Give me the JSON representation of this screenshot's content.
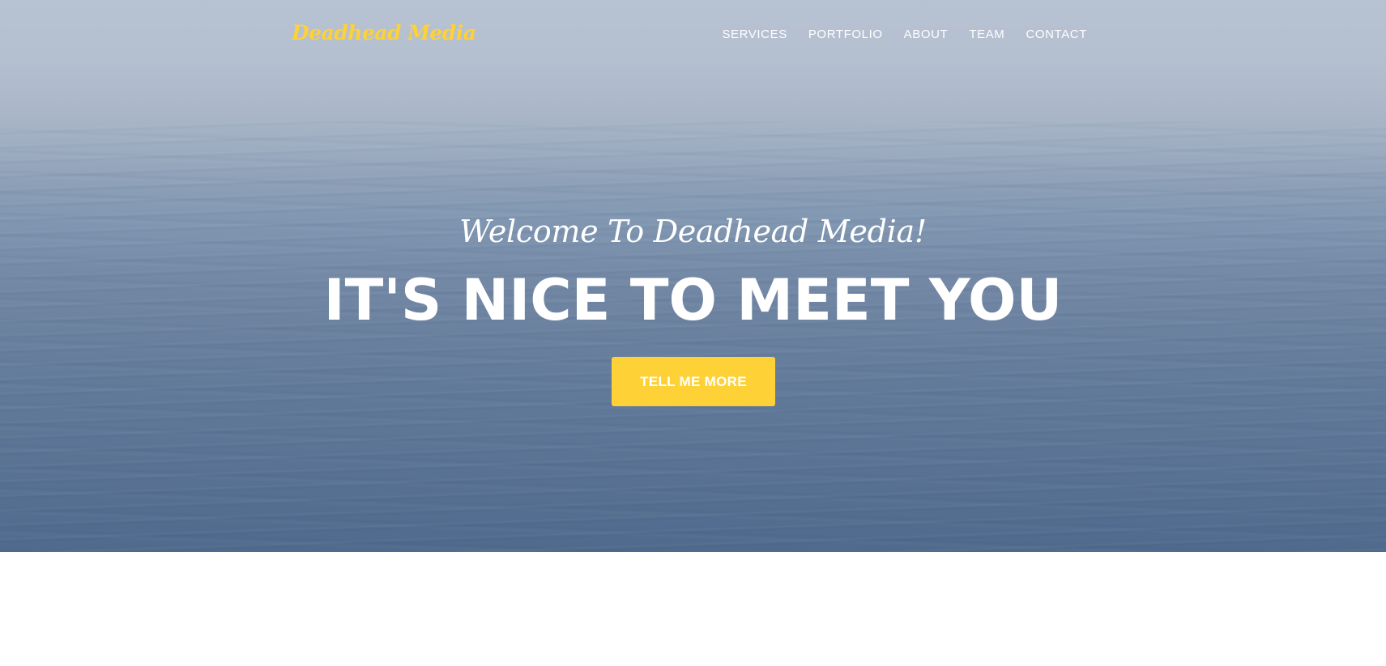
{
  "navbar": {
    "brand": "Deadhead Media",
    "links": [
      {
        "label": "SERVICES"
      },
      {
        "label": "PORTFOLIO"
      },
      {
        "label": "ABOUT"
      },
      {
        "label": "TEAM"
      },
      {
        "label": "CONTACT"
      }
    ]
  },
  "hero": {
    "lead_in": "Welcome To Deadhead Media!",
    "heading": "IT'S NICE TO MEET YOU",
    "cta_label": "TELL ME MORE"
  },
  "colors": {
    "accent": "#fed136",
    "text_on_hero": "#ffffff",
    "page_background": "#ffffff"
  }
}
